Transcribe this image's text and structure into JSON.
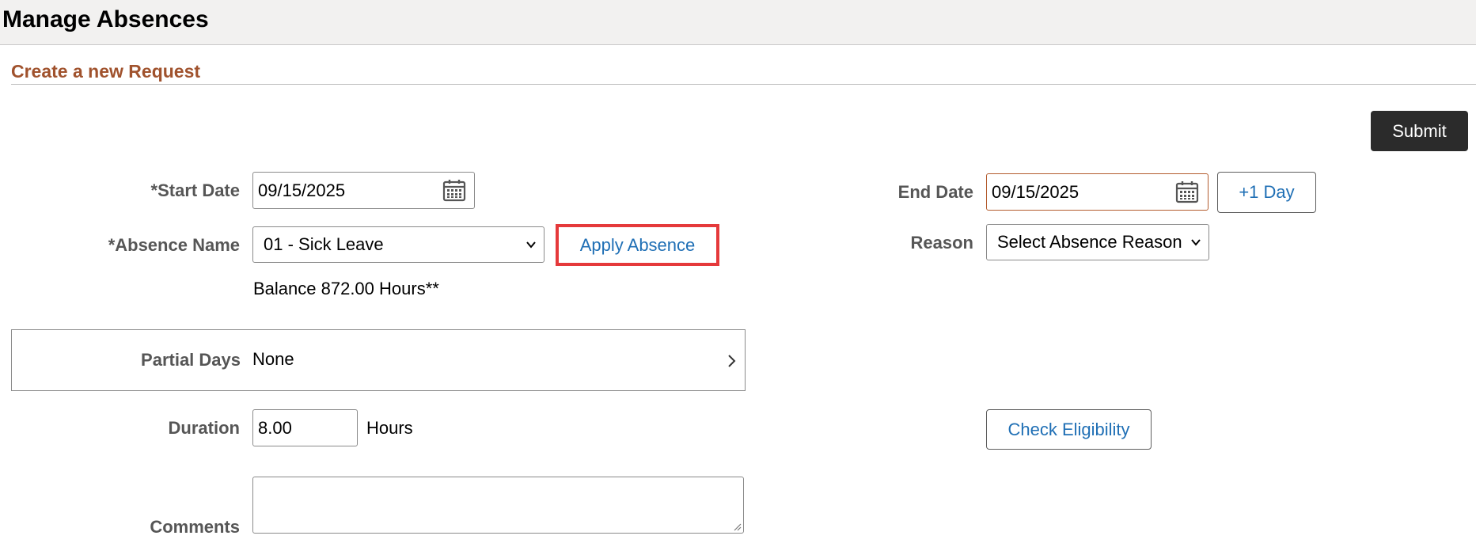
{
  "header": {
    "title": "Manage Absences"
  },
  "section": {
    "title": "Create a new Request"
  },
  "actions": {
    "submit_label": "Submit"
  },
  "form": {
    "start_date": {
      "label": "*Start Date",
      "value": "09/15/2025",
      "icon": "calendar-icon"
    },
    "end_date": {
      "label": "End Date",
      "value": "09/15/2025",
      "icon": "calendar-icon"
    },
    "plus_one_day_label": "+1 Day",
    "absence_name": {
      "label": "*Absence Name",
      "selected": "01 - Sick Leave"
    },
    "apply_absence_label": "Apply Absence",
    "balance_text": "Balance 872.00 Hours**",
    "reason": {
      "label": "Reason",
      "selected": "Select Absence Reason"
    },
    "partial_days": {
      "label": "Partial Days",
      "value": "None"
    },
    "duration": {
      "label": "Duration",
      "value": "8.00",
      "unit": "Hours"
    },
    "check_eligibility_label": "Check Eligibility",
    "comments": {
      "label": "Comments",
      "value": ""
    }
  },
  "colors": {
    "section_title": "#a0522d",
    "link_blue": "#1f6fb5",
    "highlight_red": "#e5393b",
    "submit_bg": "#2b2b2b"
  }
}
